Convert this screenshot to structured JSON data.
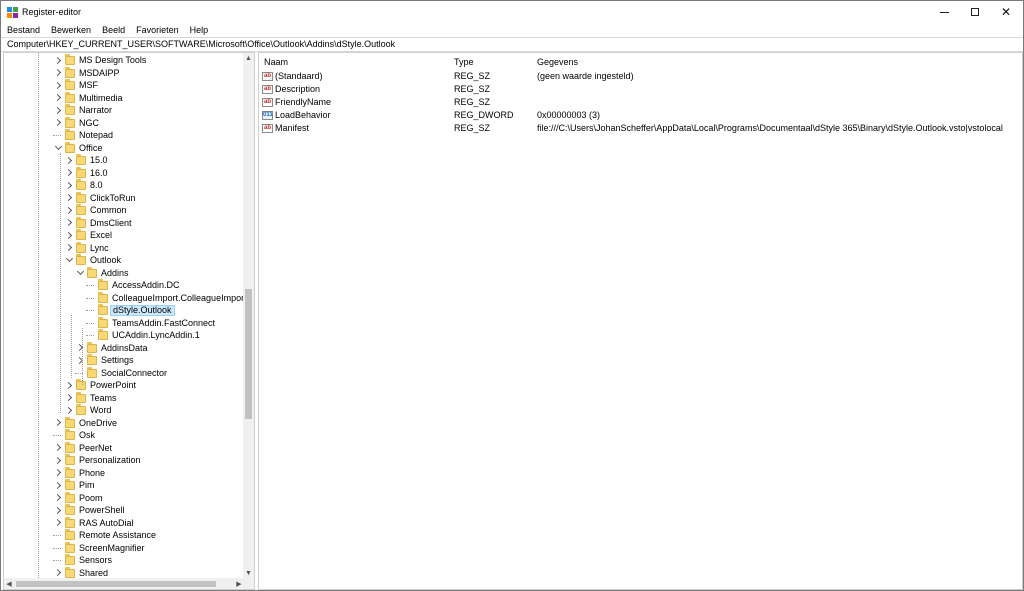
{
  "window": {
    "title": "Register-editor"
  },
  "menu": [
    "Bestand",
    "Bewerken",
    "Beeld",
    "Favorieten",
    "Help"
  ],
  "address": "Computer\\HKEY_CURRENT_USER\\SOFTWARE\\Microsoft\\Office\\Outlook\\Addins\\dStyle.Outlook",
  "tree": [
    {
      "label": "MS Design Tools",
      "depth": 0,
      "state": "collapsed"
    },
    {
      "label": "MSDAIPP",
      "depth": 0,
      "state": "collapsed"
    },
    {
      "label": "MSF",
      "depth": 0,
      "state": "collapsed"
    },
    {
      "label": "Multimedia",
      "depth": 0,
      "state": "collapsed"
    },
    {
      "label": "Narrator",
      "depth": 0,
      "state": "collapsed"
    },
    {
      "label": "NGC",
      "depth": 0,
      "state": "collapsed"
    },
    {
      "label": "Notepad",
      "depth": 0,
      "state": "leaf"
    },
    {
      "label": "Office",
      "depth": 0,
      "state": "expanded"
    },
    {
      "label": "15.0",
      "depth": 1,
      "state": "collapsed"
    },
    {
      "label": "16.0",
      "depth": 1,
      "state": "collapsed"
    },
    {
      "label": "8.0",
      "depth": 1,
      "state": "collapsed"
    },
    {
      "label": "ClickToRun",
      "depth": 1,
      "state": "collapsed"
    },
    {
      "label": "Common",
      "depth": 1,
      "state": "collapsed"
    },
    {
      "label": "DmsClient",
      "depth": 1,
      "state": "collapsed"
    },
    {
      "label": "Excel",
      "depth": 1,
      "state": "collapsed"
    },
    {
      "label": "Lync",
      "depth": 1,
      "state": "collapsed"
    },
    {
      "label": "Outlook",
      "depth": 1,
      "state": "expanded"
    },
    {
      "label": "Addins",
      "depth": 2,
      "state": "expanded"
    },
    {
      "label": "AccessAddin.DC",
      "depth": 3,
      "state": "leaf"
    },
    {
      "label": "ColleagueImport.ColleagueImportAd",
      "depth": 3,
      "state": "leaf"
    },
    {
      "label": "dStyle.Outlook",
      "depth": 3,
      "state": "leaf",
      "selected": true
    },
    {
      "label": "TeamsAddin.FastConnect",
      "depth": 3,
      "state": "leaf"
    },
    {
      "label": "UCAddin.LyncAddin.1",
      "depth": 3,
      "state": "leaf"
    },
    {
      "label": "AddinsData",
      "depth": 2,
      "state": "collapsed"
    },
    {
      "label": "Settings",
      "depth": 2,
      "state": "collapsed"
    },
    {
      "label": "SocialConnector",
      "depth": 2,
      "state": "leaf"
    },
    {
      "label": "PowerPoint",
      "depth": 1,
      "state": "collapsed"
    },
    {
      "label": "Teams",
      "depth": 1,
      "state": "collapsed"
    },
    {
      "label": "Word",
      "depth": 1,
      "state": "collapsed"
    },
    {
      "label": "OneDrive",
      "depth": 0,
      "state": "collapsed"
    },
    {
      "label": "Osk",
      "depth": 0,
      "state": "leaf"
    },
    {
      "label": "PeerNet",
      "depth": 0,
      "state": "collapsed"
    },
    {
      "label": "Personalization",
      "depth": 0,
      "state": "collapsed"
    },
    {
      "label": "Phone",
      "depth": 0,
      "state": "collapsed"
    },
    {
      "label": "Pim",
      "depth": 0,
      "state": "collapsed"
    },
    {
      "label": "Poom",
      "depth": 0,
      "state": "collapsed"
    },
    {
      "label": "PowerShell",
      "depth": 0,
      "state": "collapsed"
    },
    {
      "label": "RAS AutoDial",
      "depth": 0,
      "state": "collapsed"
    },
    {
      "label": "Remote Assistance",
      "depth": 0,
      "state": "leaf"
    },
    {
      "label": "ScreenMagnifier",
      "depth": 0,
      "state": "leaf"
    },
    {
      "label": "Sensors",
      "depth": 0,
      "state": "leaf"
    },
    {
      "label": "Shared",
      "depth": 0,
      "state": "collapsed"
    }
  ],
  "values": {
    "columns": [
      "Naam",
      "Type",
      "Gegevens"
    ],
    "rows": [
      {
        "icon": "string-value-icon",
        "name": "(Standaard)",
        "type": "REG_SZ",
        "data": "(geen waarde ingesteld)"
      },
      {
        "icon": "string-value-icon",
        "name": "Description",
        "type": "REG_SZ",
        "data": ""
      },
      {
        "icon": "string-value-icon",
        "name": "FriendlyName",
        "type": "REG_SZ",
        "data": ""
      },
      {
        "icon": "dword-value-icon",
        "name": "LoadBehavior",
        "type": "REG_DWORD",
        "data": "0x00000003 (3)"
      },
      {
        "icon": "string-value-icon",
        "name": "Manifest",
        "type": "REG_SZ",
        "data": "file:///C:\\Users\\JohanScheffer\\AppData\\Local\\Programs\\Documentaal\\dStyle 365\\Binary\\dStyle.Outlook.vsto|vstolocal"
      }
    ]
  },
  "colors": {
    "selection": "#cce8ff",
    "selection_border": "#99d1ff",
    "folder": "#f8d775"
  }
}
